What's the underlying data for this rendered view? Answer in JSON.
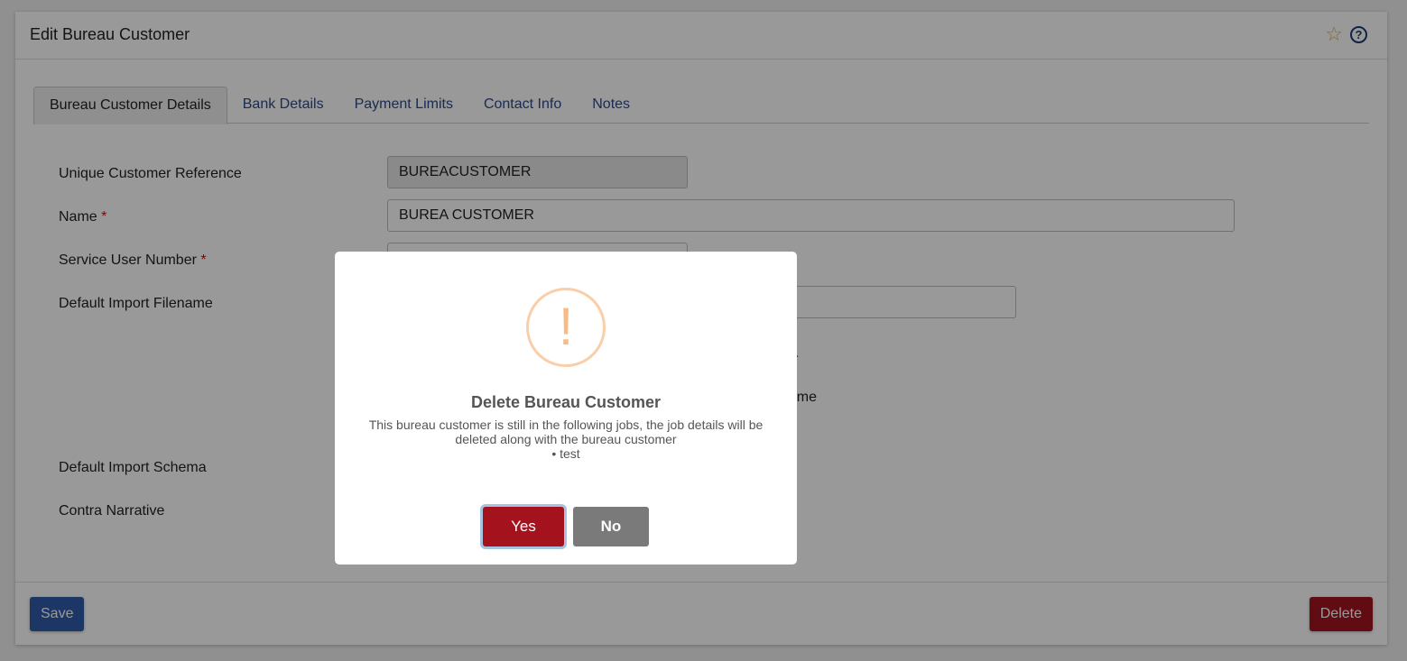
{
  "header": {
    "title": "Edit Bureau Customer",
    "favourite_icon": "star-outline-icon",
    "help_icon": "question-circle-icon"
  },
  "tabs": [
    {
      "label": "Bureau Customer Details",
      "active": true
    },
    {
      "label": "Bank Details",
      "active": false
    },
    {
      "label": "Payment Limits",
      "active": false
    },
    {
      "label": "Contact Info",
      "active": false
    },
    {
      "label": "Notes",
      "active": false
    }
  ],
  "form": {
    "unique_customer_reference": {
      "label": "Unique Customer Reference",
      "value": "BUREACUSTOMER"
    },
    "name": {
      "label": "Name",
      "required_mark": "*",
      "value": "BUREA CUSTOMER"
    },
    "service_user_number": {
      "label": "Service User Number",
      "required_mark": "*",
      "value": ""
    },
    "default_import_filename": {
      "label": "Default Import Filename",
      "value": ""
    },
    "partial_option_text_1": "r",
    "partial_option_text_2": "te/time",
    "default_import_schema": {
      "label": "Default Import Schema"
    },
    "contra_narrative": {
      "label": "Contra Narrative"
    }
  },
  "footer": {
    "save_label": "Save",
    "delete_label": "Delete"
  },
  "modal": {
    "icon": "exclamation-warning-icon",
    "icon_glyph": "!",
    "title": "Delete Bureau Customer",
    "message": "This bureau customer is still in the following jobs, the job details will be deleted along with the bureau customer",
    "jobs": [
      "test"
    ],
    "yes_label": "Yes",
    "no_label": "No"
  }
}
